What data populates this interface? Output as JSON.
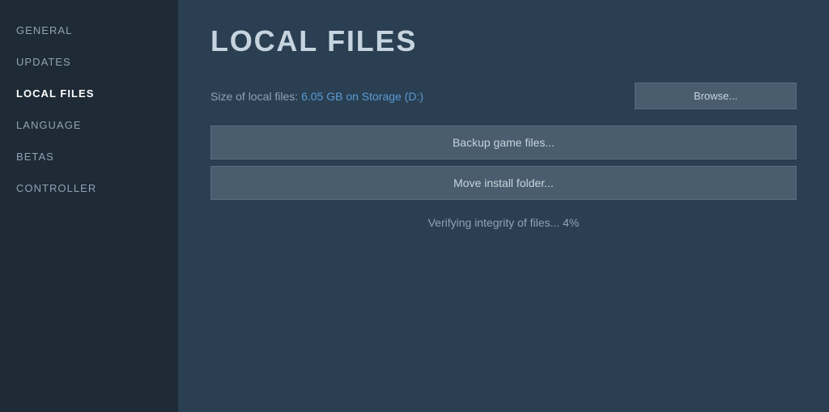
{
  "sidebar": {
    "items": [
      {
        "id": "general",
        "label": "GENERAL",
        "active": false
      },
      {
        "id": "updates",
        "label": "UPDATES",
        "active": false
      },
      {
        "id": "local-files",
        "label": "LOCAL FILES",
        "active": true
      },
      {
        "id": "language",
        "label": "LANGUAGE",
        "active": false
      },
      {
        "id": "betas",
        "label": "BETAS",
        "active": false
      },
      {
        "id": "controller",
        "label": "CONTROLLER",
        "active": false
      }
    ]
  },
  "main": {
    "page_title": "LOCAL FILES",
    "file_size_label": "Size of local files:",
    "file_size_value": "6.05 GB on Storage (D:)",
    "browse_button_label": "Browse...",
    "backup_button_label": "Backup game files...",
    "move_install_button_label": "Move install folder...",
    "verify_status": "Verifying integrity of files... 4%"
  }
}
